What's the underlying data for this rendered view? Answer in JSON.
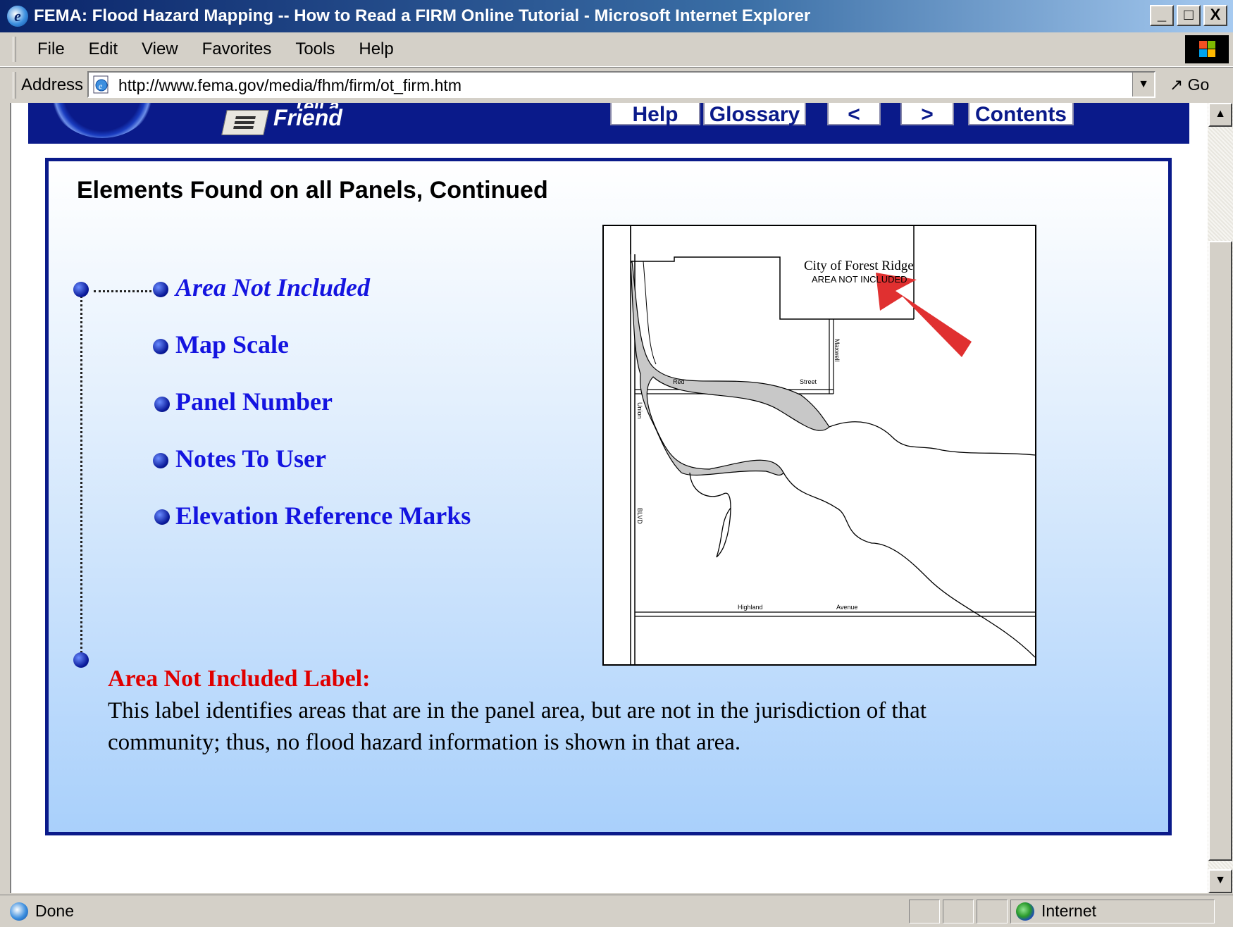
{
  "window": {
    "title": "FEMA: Flood Hazard Mapping -- How to Read a FIRM Online Tutorial - Microsoft Internet Explorer",
    "minimize": "_",
    "maximize": "□",
    "close": "X"
  },
  "menu": {
    "items": [
      {
        "label": "File",
        "key": "F"
      },
      {
        "label": "Edit",
        "key": "E"
      },
      {
        "label": "View",
        "key": "V"
      },
      {
        "label": "Favorites",
        "key": "a"
      },
      {
        "label": "Tools",
        "key": "T"
      },
      {
        "label": "Help",
        "key": "H"
      }
    ]
  },
  "address": {
    "label": "Address",
    "url": "http://www.fema.gov/media/fhm/firm/ot_firm.htm",
    "go_label": "Go"
  },
  "header": {
    "tell_a_friend_top": "Tell a",
    "tell_a_friend": "Friend",
    "nav": {
      "help": "Help",
      "glossary": "Glossary",
      "prev": "<",
      "next": ">",
      "contents": "Contents"
    },
    "band_color": "#0a1a8a"
  },
  "panel": {
    "title": "Elements Found on all Panels, Continued",
    "topics": [
      {
        "label": "Area Not Included",
        "active": true
      },
      {
        "label": "Map Scale",
        "active": false
      },
      {
        "label": "Panel Number",
        "active": false
      },
      {
        "label": "Notes To User",
        "active": false
      },
      {
        "label": "Elevation Reference Marks",
        "active": false
      }
    ],
    "description_label": "Area Not Included Label:",
    "description": "This label identifies areas that are in the panel area, but are not in the jurisdiction of that community; thus, no flood hazard information is shown in that area."
  },
  "map": {
    "city": "City of Forest Ridge",
    "area_label": "AREA NOT INCLUDED",
    "streets": {
      "red": "Red",
      "street": "Street",
      "maxwell": "Maxwell",
      "union": "Union",
      "blvd": "BLVD",
      "highland": "Highland",
      "avenue": "Avenue"
    },
    "arrow_color": "#e03030"
  },
  "status": {
    "text": "Done",
    "zone": "Internet"
  }
}
